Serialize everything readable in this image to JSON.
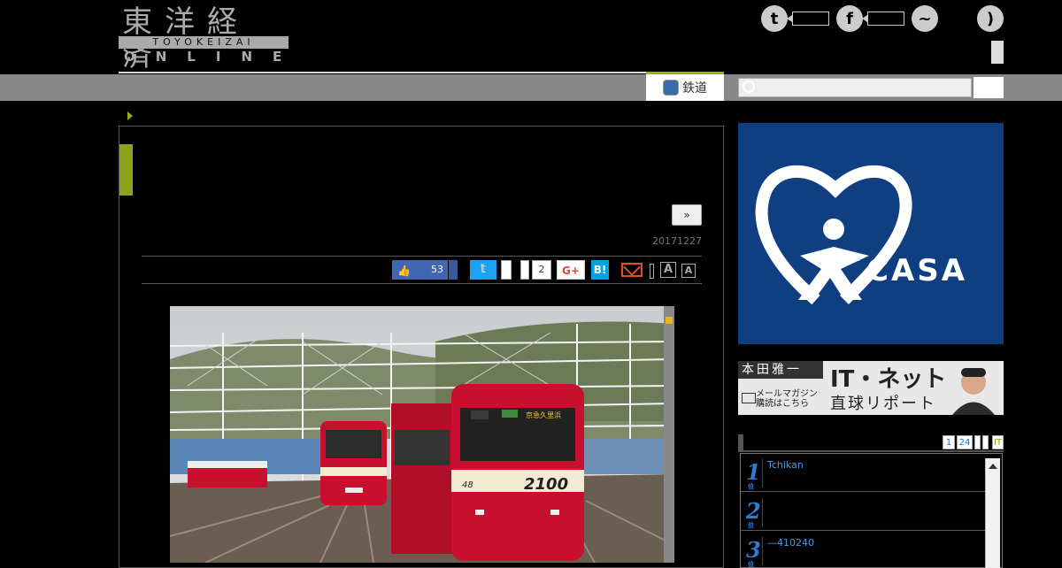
{
  "header": {
    "logo_kanji": "東洋経済",
    "logo_band": "TOYOKEIZAI",
    "logo_online": "ONLINE",
    "sns": [
      {
        "icon": "twitter-icon",
        "label": "t"
      },
      {
        "icon": "facebook-icon",
        "label": "f"
      },
      {
        "icon": "messenger-icon",
        "label": "~"
      },
      {
        "icon": "rss-icon",
        "label": ")"
      }
    ]
  },
  "nav": {
    "rail_label": "鉄道",
    "search_placeholder": ""
  },
  "article": {
    "next_label": "»",
    "date": "20171227",
    "fb_like_count": "53",
    "fb_like_icon": "thumbs-up-icon",
    "hatena_count": "2",
    "gplus_label": "G+",
    "hatena_label": "B!",
    "font_large": "A",
    "font_small": "A",
    "photo": {
      "destination_text": "京急久里浜",
      "car_number": "2100",
      "car_unit": "48",
      "colors": {
        "train_red": "#c8102e",
        "train_cream": "#f2ead2"
      }
    }
  },
  "sidebar": {
    "ad_casa": {
      "brand": "CASA",
      "reg": "®",
      "bg": "#0f3f80"
    },
    "ad_honda": {
      "name": "本田雅一",
      "mail_line1": "メールマガジン",
      "mail_line2": "購読はこちら",
      "title1": "IT・ネット",
      "title2": "直球リポート"
    },
    "ranking": {
      "tabs": [
        "1",
        "24",
        "",
        "",
        "IT"
      ],
      "items": [
        {
          "rank": "1",
          "suffix": "位",
          "title": "Tchikan"
        },
        {
          "rank": "2",
          "suffix": "位",
          "title": ""
        },
        {
          "rank": "3",
          "suffix": "位",
          "title": "—410240"
        }
      ]
    }
  },
  "colors": {
    "accent_green": "#9ab013",
    "nav_gray": "#888888",
    "fb_blue": "#4267b2",
    "twitter_blue": "#1da1f2",
    "hatena_blue": "#00a4de"
  }
}
